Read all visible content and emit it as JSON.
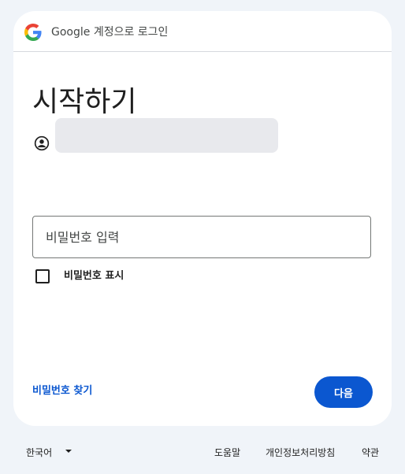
{
  "header": {
    "brand_title": "Google 계정으로 로그인"
  },
  "main": {
    "title": "시작하기",
    "account_email": "",
    "password_placeholder": "비밀번호 입력",
    "password_value": "",
    "show_password_label": "비밀번호 표시",
    "show_password_checked": false,
    "forgot_password_label": "비밀번호 찾기",
    "next_label": "다음"
  },
  "footer": {
    "language": "한국어",
    "links": [
      "도움말",
      "개인정보처리방침",
      "약관"
    ]
  },
  "colors": {
    "background": "#f0f4f9",
    "primary": "#0b57d0",
    "card": "#ffffff",
    "text": "#1f1f1f"
  },
  "icons": {
    "brand": "google-g-icon",
    "account": "account-circle-icon",
    "language_dropdown": "caret-down-icon"
  }
}
